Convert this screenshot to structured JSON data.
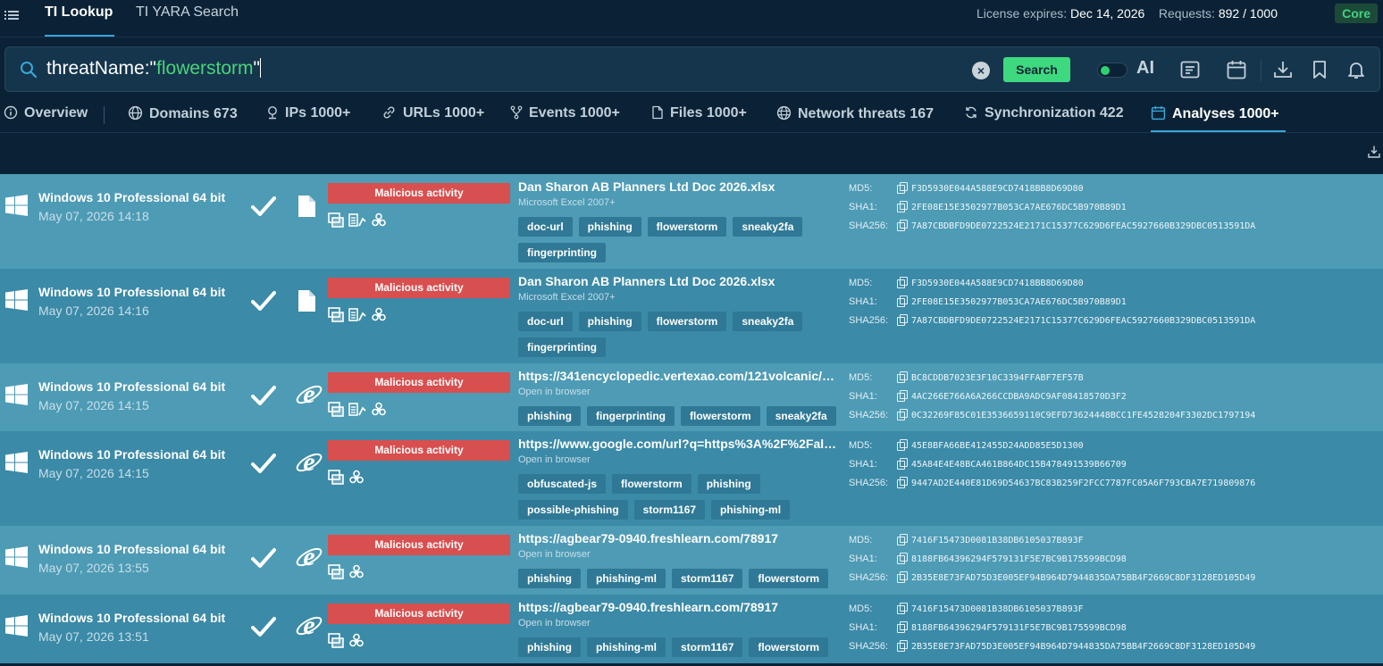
{
  "topbar": {
    "tabs": [
      {
        "label": "TI Lookup"
      },
      {
        "label": "TI YARA Search"
      }
    ],
    "license_label": "License expires:",
    "license_value": "Dec 14, 2026",
    "requests_label": "Requests:",
    "requests_value": "892 / 1000",
    "plan": "Core"
  },
  "search": {
    "query_prefix": "threatName:\"",
    "query_value": "flowerstorm",
    "query_suffix": "\"",
    "button": "Search",
    "ai_label": "AI",
    "ai_enabled": true
  },
  "nav": {
    "tabs": [
      {
        "label": "Overview",
        "icon": "info-icon"
      },
      {
        "label": "Domains 673",
        "icon": "globe-icon"
      },
      {
        "label": "IPs 1000+",
        "icon": "location-icon"
      },
      {
        "label": "URLs 1000+",
        "icon": "link-icon"
      },
      {
        "label": "Events 1000+",
        "icon": "fork-icon"
      },
      {
        "label": "Files 1000+",
        "icon": "file-icon"
      },
      {
        "label": "Network threats 167",
        "icon": "network-icon"
      },
      {
        "label": "Synchronization 422",
        "icon": "sync-icon"
      },
      {
        "label": "Analyses 1000+",
        "icon": "calendar-icon"
      }
    ],
    "active": "Analyses 1000+"
  },
  "colors": {
    "accent": "#3aa6d8",
    "search_button": "#3ed97e",
    "malicious": "#d84f4f",
    "row_light": "#4e9bb5",
    "row_dark": "#3b8aa7",
    "tag": "#2f7996"
  },
  "analyses": [
    {
      "os": "Windows 10 Professional 64 bit",
      "date": "May 07, 2026 14:18",
      "file_icon": "document-icon",
      "verdict": "Malicious activity",
      "title": "Dan Sharon AB Planners Ltd Doc 2026.xlsx",
      "subtitle": "Microsoft Excel 2007+",
      "tags": [
        "doc-url",
        "phishing",
        "flowerstorm",
        "sneaky2fa",
        "fingerprinting"
      ],
      "md5_label": "MD5:",
      "sha1_label": "SHA1:",
      "sha256_label": "SHA256:",
      "md5": "F3D5930E044A588E9CD7418BB8D69D80",
      "sha1": "2FE08E15E3502977B053CA7AE676DC5B970B89D1",
      "sha256": "7A87CBDBFD9DE0722524E2171C15377C629D6FEAC5927660B329DBC0513591DA"
    },
    {
      "os": "Windows 10 Professional 64 bit",
      "date": "May 07, 2026 14:16",
      "file_icon": "document-icon",
      "verdict": "Malicious activity",
      "title": "Dan Sharon AB Planners Ltd Doc 2026.xlsx",
      "subtitle": "Microsoft Excel 2007+",
      "tags": [
        "doc-url",
        "phishing",
        "flowerstorm",
        "sneaky2fa",
        "fingerprinting"
      ],
      "md5_label": "MD5:",
      "sha1_label": "SHA1:",
      "sha256_label": "SHA256:",
      "md5": "F3D5930E044A588E9CD7418BB8D69D80",
      "sha1": "2FE08E15E3502977B053CA7AE676DC5B970B89D1",
      "sha256": "7A87CBDBFD9DE0722524E2171C15377C629D6FEAC5927660B329DBC0513591DA"
    },
    {
      "os": "Windows 10 Professional 64 bit",
      "date": "May 07, 2026 14:15",
      "file_icon": "internet-explorer-icon",
      "verdict": "Malicious activity",
      "title": "https://341encyclopedic.vertexao.com/121volcanic/$…",
      "subtitle": "Open in browser",
      "tags": [
        "phishing",
        "fingerprinting",
        "flowerstorm",
        "sneaky2fa"
      ],
      "md5_label": "MD5:",
      "sha1_label": "SHA1:",
      "sha256_label": "SHA256:",
      "md5": "BC8CDDB7023E3F10C3394FFABF7EF57B",
      "sha1": "4AC266E766A6A266CCDBA9ADC9AF08418570D3F2",
      "sha256": "0C32269F85C01E3536659110C9EFD73624448BCC1FE4528204F3302DC1797194"
    },
    {
      "os": "Windows 10 Professional 64 bit",
      "date": "May 07, 2026 14:15",
      "file_icon": "internet-explorer-icon",
      "verdict": "Malicious activity",
      "title": "https://www.google.com/url?q=https%3A%2F%2Falhs…",
      "subtitle": "Open in browser",
      "tags": [
        "obfuscated-js",
        "flowerstorm",
        "phishing",
        "possible-phishing",
        "storm1167",
        "phishing-ml"
      ],
      "md5_label": "MD5:",
      "sha1_label": "SHA1:",
      "sha256_label": "SHA256:",
      "md5": "45E8BFA66BE412455D24ADD85E5D1300",
      "sha1": "45A84E4E48BCA461B864DC15B478491539B66709",
      "sha256": "9447AD2E440E81D69D54637BC83B259F2FCC7787FC05A6F793CBA7E719809876"
    },
    {
      "os": "Windows 10 Professional 64 bit",
      "date": "May 07, 2026 13:55",
      "file_icon": "internet-explorer-icon",
      "verdict": "Malicious activity",
      "title": "https://agbear79-0940.freshlearn.com/78917",
      "subtitle": "Open in browser",
      "tags": [
        "phishing",
        "phishing-ml",
        "storm1167",
        "flowerstorm"
      ],
      "md5_label": "MD5:",
      "sha1_label": "SHA1:",
      "sha256_label": "SHA256:",
      "md5": "7416F15473D0081B38DB6105037B893F",
      "sha1": "8188FB64396294F579131F5E7BC9B175599BCD98",
      "sha256": "2B35E8E73FAD75D3E005EF94B964D7944835DA75BB4F2669C8DF3128ED105D49"
    },
    {
      "os": "Windows 10 Professional 64 bit",
      "date": "May 07, 2026 13:51",
      "file_icon": "internet-explorer-icon",
      "verdict": "Malicious activity",
      "title": "https://agbear79-0940.freshlearn.com/78917",
      "subtitle": "Open in browser",
      "tags": [
        "phishing",
        "phishing-ml",
        "storm1167",
        "flowerstorm"
      ],
      "md5_label": "MD5:",
      "sha1_label": "SHA1:",
      "sha256_label": "SHA256:",
      "md5": "7416F15473D0081B38DB6105037B893F",
      "sha1": "8188FB64396294F579131F5E7BC9B175599BCD98",
      "sha256": "2B35E8E73FAD75D3E005EF94B964D7944835DA75BB4F2669C8DF3128ED105D49"
    }
  ]
}
